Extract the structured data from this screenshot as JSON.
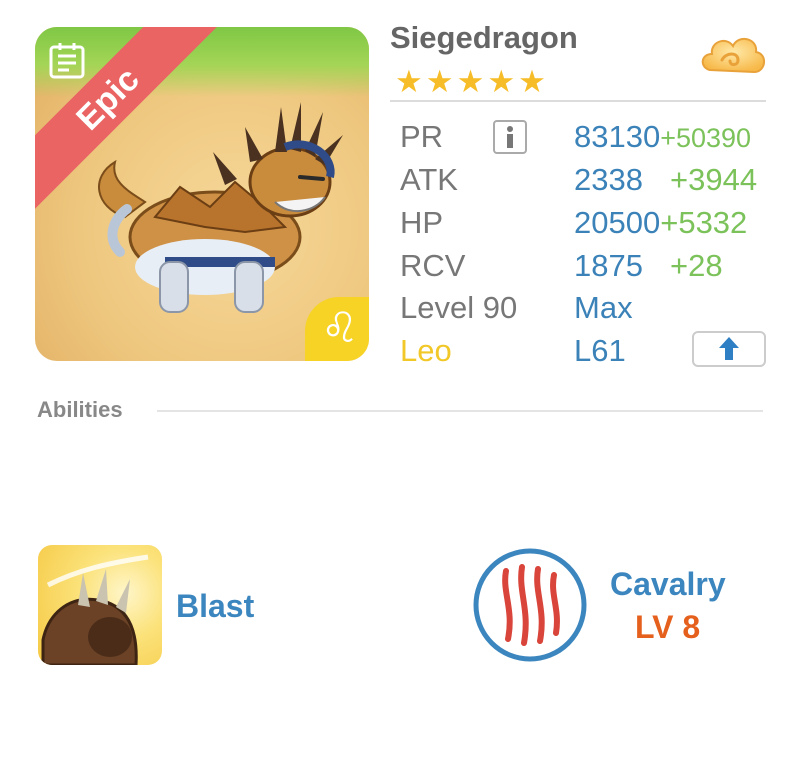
{
  "monster": {
    "name": "Siegedragon",
    "rarity": "Epic",
    "stars": "★★★★★",
    "zodiac_symbol": "♌"
  },
  "stats": [
    {
      "label": "PR",
      "value": "83130",
      "bonus": "+50390"
    },
    {
      "label": "ATK",
      "value": "2338",
      "bonus": "+3944"
    },
    {
      "label": "HP",
      "value": "20500",
      "bonus": "+5332"
    },
    {
      "label": "RCV",
      "value": "1875",
      "bonus": "+28"
    },
    {
      "label": "Level 90",
      "value": "Max",
      "bonus": ""
    },
    {
      "label": "Leo",
      "value": "L61",
      "bonus": ""
    }
  ],
  "abilities": {
    "section_label": "Abilities",
    "skill": {
      "name": "Blast"
    },
    "trait": {
      "name": "Cavalry",
      "level": "LV 8"
    }
  },
  "colors": {
    "accent_blue": "#3b82b8",
    "bonus_green": "#7cc25a",
    "epic_red": "#e96463",
    "zodiac_yellow": "#f6d325",
    "level_orange": "#e5601c"
  }
}
